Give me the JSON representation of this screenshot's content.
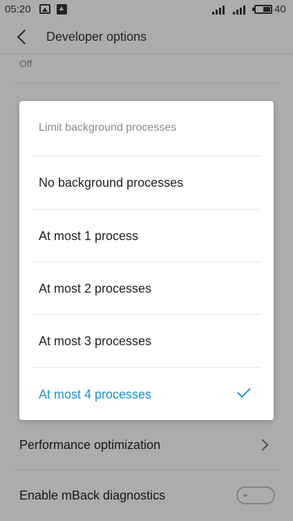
{
  "status_bar": {
    "time": "05:20",
    "battery_level": "40",
    "icons": [
      "image-icon",
      "upload-icon",
      "signal-icon",
      "signal-icon",
      "battery-icon"
    ]
  },
  "app_bar": {
    "title": "Developer options"
  },
  "background": {
    "top_item_value": "Off",
    "items": [
      {
        "label": "Performance optimization",
        "trailing": "chevron-right-icon"
      },
      {
        "label": "Enable mBack diagnostics",
        "trailing": "toggle"
      }
    ],
    "toggle_state": "off"
  },
  "dialog": {
    "title": "Limit background processes",
    "options": [
      {
        "label": "No background processes",
        "selected": false
      },
      {
        "label": "At most 1 process",
        "selected": false
      },
      {
        "label": "At most 2 processes",
        "selected": false
      },
      {
        "label": "At most 3 processes",
        "selected": false
      },
      {
        "label": "At most 4 processes",
        "selected": true
      }
    ],
    "accent_color": "#1a93c9"
  }
}
